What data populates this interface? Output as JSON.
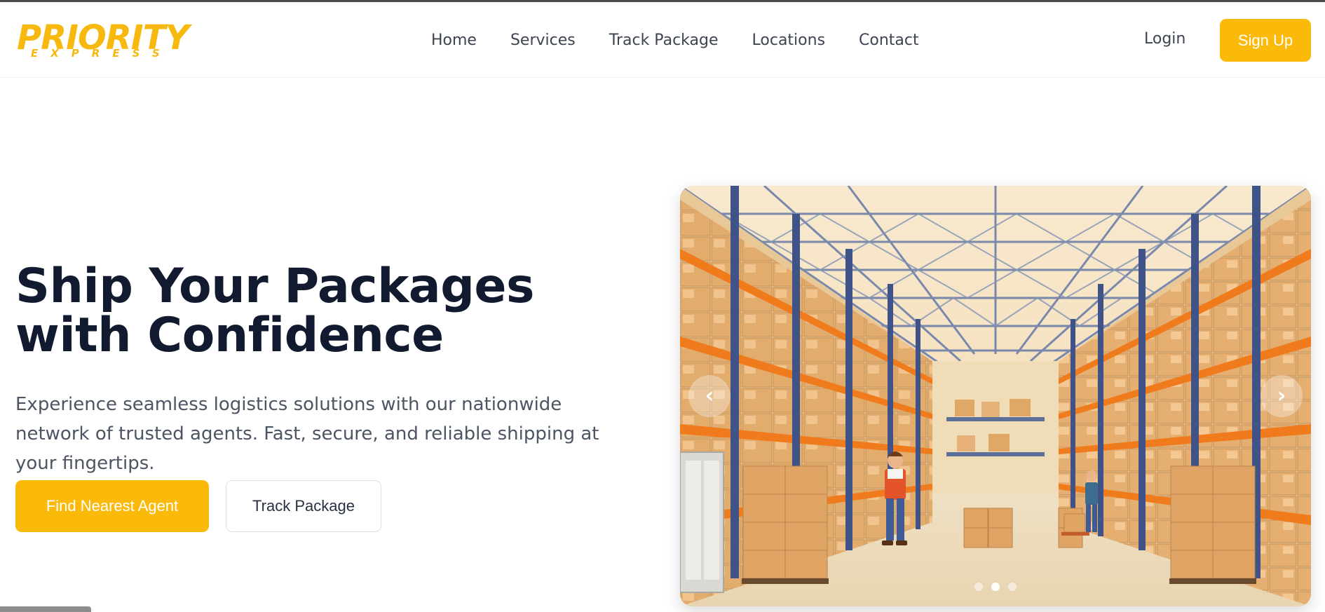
{
  "brand": {
    "name": "PRIORITY",
    "tagline": "EXPRESS",
    "color": "#f7b80f"
  },
  "nav": {
    "links": [
      "Home",
      "Services",
      "Track Package",
      "Locations",
      "Contact"
    ],
    "login_label": "Login",
    "signup_label": "Sign Up"
  },
  "hero": {
    "title": "Ship Your Packages with Confidence",
    "description": "Experience seamless logistics solutions with our nationwide network of trusted agents. Fast, secure, and reliable shipping at your fingertips.",
    "primary_button": "Find Nearest Agent",
    "secondary_button": "Track Package"
  },
  "carousel": {
    "image": "warehouse-illustration",
    "prev_icon": "chevron-left-icon",
    "next_icon": "chevron-right-icon",
    "slide_count": 3,
    "active_slide": 2
  },
  "colors": {
    "accent": "#fbb90a",
    "heading": "#121a2f",
    "body_text": "#4b5563"
  }
}
